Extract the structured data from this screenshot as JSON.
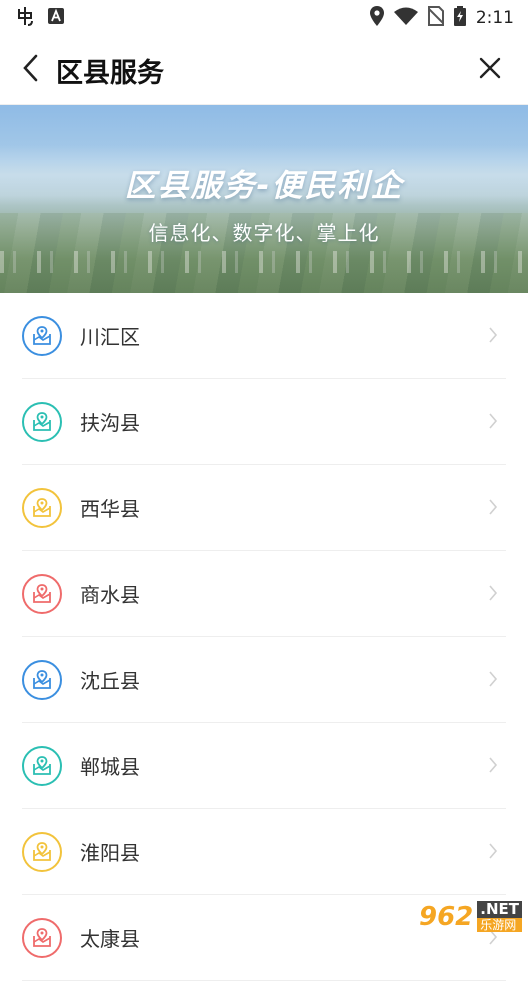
{
  "status_bar": {
    "time": "2:11",
    "left_icons": [
      "bug-icon",
      "text-a-icon"
    ],
    "right_icons": [
      "location-icon",
      "wifi-icon",
      "no-sim-icon",
      "battery-charging-icon"
    ]
  },
  "header": {
    "title": "区县服务",
    "back_icon": "chevron-left-icon",
    "close_icon": "close-icon"
  },
  "banner": {
    "title": "区县服务-便民利企",
    "subtitle": "信息化、数字化、掌上化"
  },
  "colors": {
    "blue": "#3b8fe0",
    "teal": "#2bbfb3",
    "yellow": "#f2c33c",
    "red": "#ef6b6b"
  },
  "districts": [
    {
      "label": "川汇区",
      "color": "blue"
    },
    {
      "label": "扶沟县",
      "color": "teal"
    },
    {
      "label": "西华县",
      "color": "yellow"
    },
    {
      "label": "商水县",
      "color": "red"
    },
    {
      "label": "沈丘县",
      "color": "blue"
    },
    {
      "label": "郸城县",
      "color": "teal"
    },
    {
      "label": "淮阳县",
      "color": "yellow"
    },
    {
      "label": "太康县",
      "color": "red"
    }
  ],
  "watermark": {
    "number": "962",
    "net": ".NET",
    "cn": "乐游网"
  }
}
